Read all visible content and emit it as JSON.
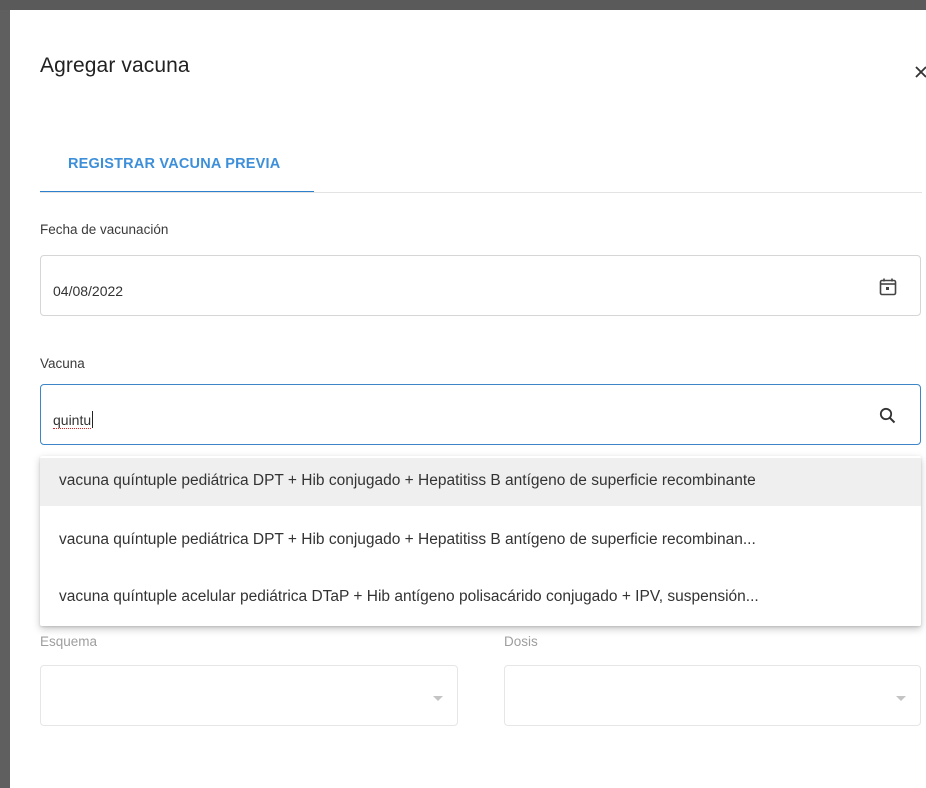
{
  "dialog": {
    "title": "Agregar vacuna",
    "tabs": [
      {
        "label": "REGISTRAR VACUNA PREVIA",
        "active": true
      }
    ]
  },
  "form": {
    "fecha": {
      "label": "Fecha de vacunación",
      "value": "04/08/2022",
      "icon": "calendar-icon"
    },
    "vacuna": {
      "label": "Vacuna",
      "value": "quintu",
      "icon": "search-icon"
    },
    "esquema": {
      "label": "Esquema",
      "value": ""
    },
    "dosis": {
      "label": "Dosis",
      "value": ""
    }
  },
  "autocomplete": {
    "options": [
      "vacuna quíntuple pediátrica DPT + Hib conjugado + Hepatitiss B antígeno de superficie recombinante",
      "vacuna quíntuple pediátrica DPT + Hib conjugado + Hepatitiss B antígeno de superficie recombinan...",
      "vacuna quíntuple acelular pediátrica DTaP + Hib antígeno polisacárido conjugado + IPV, suspensión..."
    ]
  },
  "colors": {
    "accent": "#3d8fd9",
    "focus_border": "#3c86c8",
    "hover_bg": "#efefef"
  }
}
